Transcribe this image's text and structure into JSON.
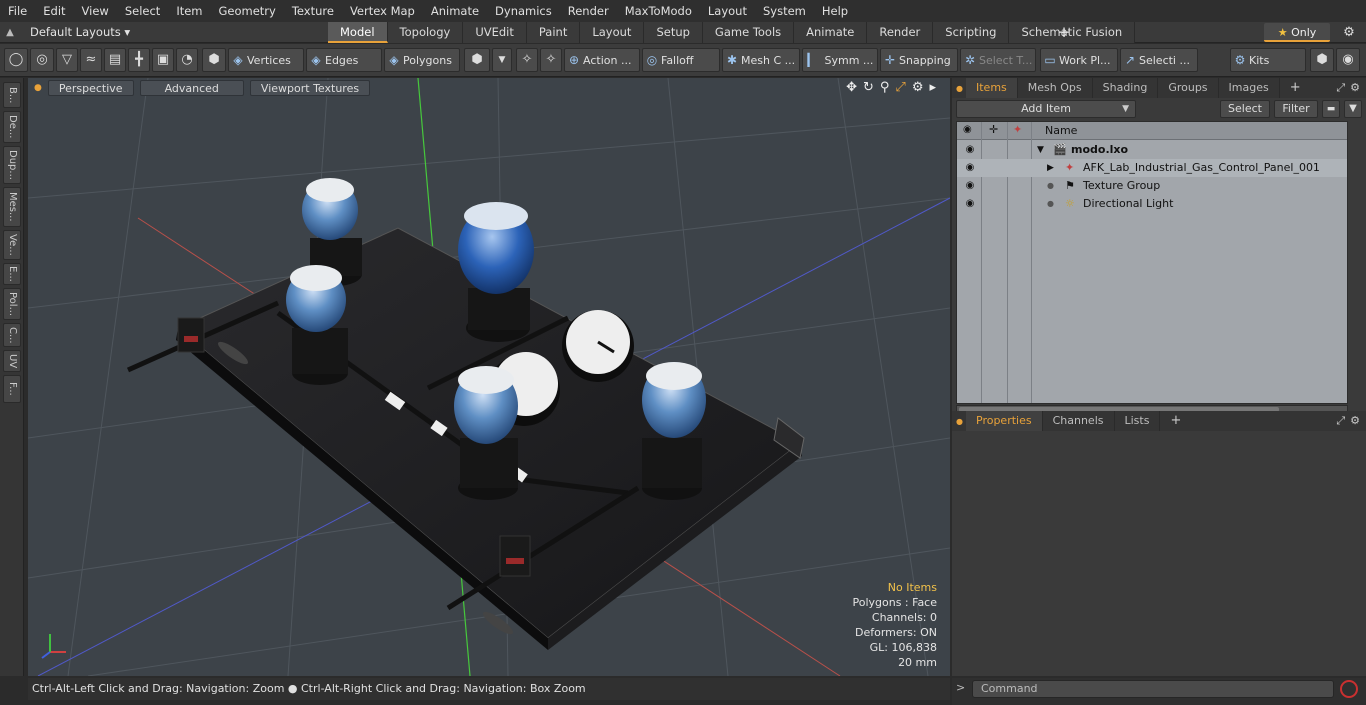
{
  "menu": [
    "File",
    "Edit",
    "View",
    "Select",
    "Item",
    "Geometry",
    "Texture",
    "Vertex Map",
    "Animate",
    "Dynamics",
    "Render",
    "MaxToModo",
    "Layout",
    "System",
    "Help"
  ],
  "layout": {
    "default_layouts": "Default Layouts ▾",
    "tabs": [
      "Model",
      "Topology",
      "UVEdit",
      "Paint",
      "Layout",
      "Setup",
      "Game Tools",
      "Animate",
      "Render",
      "Scripting",
      "Schematic Fusion"
    ],
    "active_tab": "Model",
    "only_label": "Only"
  },
  "toolbar": {
    "vertices": "Vertices",
    "edges": "Edges",
    "polygons": "Polygons",
    "action": "Action",
    "falloff": "Falloff",
    "mesh": "Mesh C ...",
    "symm": "Symm ...",
    "snapping": "Snapping",
    "select_t": "Select T...",
    "work_pl": "Work Pl...",
    "selecti": "Selecti ...",
    "kits": "Kits"
  },
  "left_tabs": [
    "B...",
    "De...",
    "Dup...",
    "Mes...",
    "Ve...",
    "E...",
    "Pol...",
    "C...",
    "UV",
    "F..."
  ],
  "viewport": {
    "view_mode": "Perspective",
    "advanced": "Advanced",
    "textures": "Viewport Textures",
    "info": {
      "no_items": "No Items",
      "polygons": "Polygons : Face",
      "channels": "Channels: 0",
      "deformers": "Deformers: ON",
      "gl": "GL: 106,838",
      "scale": "20 mm"
    }
  },
  "status_bar": "Ctrl-Alt-Left Click and Drag: Navigation: Zoom ● Ctrl-Alt-Right Click and Drag: Navigation: Box Zoom",
  "items_panel": {
    "tabs": [
      "Items",
      "Mesh Ops",
      "Shading",
      "Groups",
      "Images"
    ],
    "active": "Items",
    "add_item": "Add Item",
    "select": "Select",
    "filter": "Filter",
    "name_col": "Name",
    "tree": [
      {
        "label": "modo.lxo"
      },
      {
        "label": "AFK_Lab_Industrial_Gas_Control_Panel_001"
      },
      {
        "label": "Texture Group"
      },
      {
        "label": "Directional Light"
      }
    ]
  },
  "properties_panel": {
    "tabs": [
      "Properties",
      "Channels",
      "Lists"
    ],
    "active": "Properties"
  },
  "command": {
    "placeholder": "Command"
  },
  "colors": {
    "accent": "#e8a23a",
    "viewport_bg": "#3d4349",
    "panel_bg": "#3a3a3a",
    "tree_bg": "#a2a6ab"
  }
}
